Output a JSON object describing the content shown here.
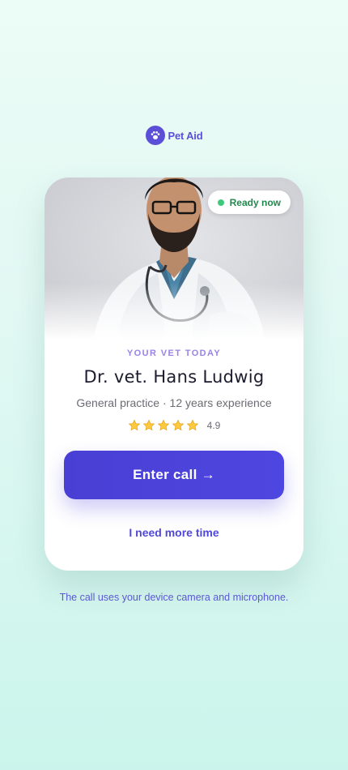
{
  "brand": {
    "name": "Pet Aid",
    "icon": "paw-icon",
    "color": "#5b4fd8"
  },
  "vet_card": {
    "status": "Ready now",
    "status_color": "#3ec97a",
    "eyebrow": "YOUR VET TODAY",
    "name": "Dr. vet. Hans Ludwig",
    "subtitle": "General practice · 12 years experience",
    "rating": 4.9,
    "rating_label": "4.9",
    "stars": 5
  },
  "actions": {
    "enter_call": "Enter call →",
    "more_time": "I need more time"
  },
  "footnote": "The call uses your device camera and microphone.",
  "colors": {
    "accent": "#4e46e0",
    "eyebrow": "#9a83e6",
    "background": "#e2f8f3"
  }
}
